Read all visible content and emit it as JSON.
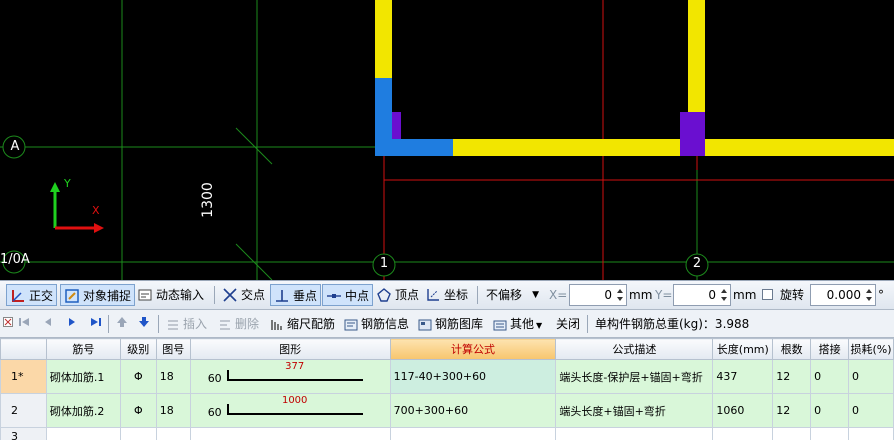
{
  "canvas": {
    "axis_labels": {
      "top_left": "A",
      "bottom_left": "1/0A",
      "col_1": "1",
      "col_2": "2"
    },
    "dimension": "1300",
    "ucs": {
      "x": "X",
      "y": "Y"
    }
  },
  "snap_toolbar": {
    "ortho": "正交",
    "object_snap": "对象捕捉",
    "dynamic_input": "动态输入",
    "intersection": "交点",
    "perpendicular": "垂点",
    "midpoint": "中点",
    "vertex": "顶点",
    "coordinate": "坐标",
    "offset_mode": "不偏移",
    "x_label": "X=",
    "x_value": "0",
    "x_unit": "mm",
    "y_label": "Y=",
    "y_value": "0",
    "y_unit": "mm",
    "rotate_label": "旋转",
    "rotate_value": "0.000",
    "degree": "°"
  },
  "rebar_toolbar": {
    "insert": "插入",
    "delete": "删除",
    "scale_rebar": "缩尺配筋",
    "rebar_info": "钢筋信息",
    "rebar_library": "钢筋图库",
    "other": "其他",
    "close": "关闭",
    "total_weight": "单构件钢筋总重(kg)：3.988"
  },
  "table": {
    "headers": [
      "",
      "筋号",
      "级别",
      "图号",
      "图形",
      "计算公式",
      "公式描述",
      "长度(mm)",
      "根数",
      "搭接",
      "损耗(%)"
    ],
    "rows": [
      {
        "num": "1*",
        "name": "砌体加筋.1",
        "grade": "Φ",
        "fig": "18",
        "lead": "60",
        "shape_len": "377",
        "formula": "117-40+300+60",
        "desc": "端头长度-保护层+锚固+弯折",
        "length": "437",
        "count": "12",
        "lap": "0",
        "loss": "0"
      },
      {
        "num": "2",
        "name": "砌体加筋.2",
        "grade": "Φ",
        "fig": "18",
        "lead": "60",
        "shape_len": "1000",
        "formula": "700+300+60",
        "desc": "端头长度+锚固+弯折",
        "length": "1060",
        "count": "12",
        "lap": "0",
        "loss": "0"
      }
    ],
    "empty_row_num": "3"
  }
}
